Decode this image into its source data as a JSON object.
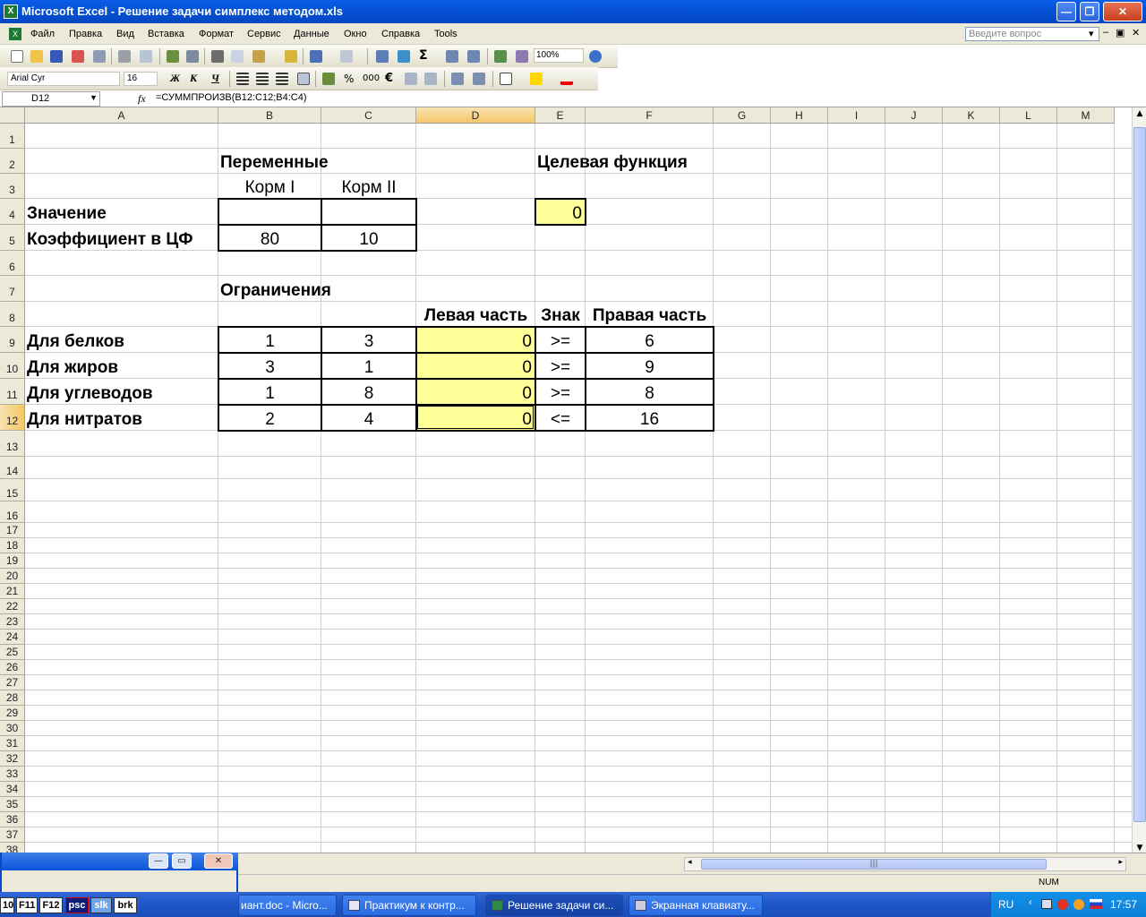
{
  "window": {
    "title": "Microsoft Excel - Решение задачи симплекс методом.xls"
  },
  "menu": {
    "items": [
      "Файл",
      "Правка",
      "Вид",
      "Вставка",
      "Формат",
      "Сервис",
      "Данные",
      "Окно",
      "Справка",
      "Tools"
    ],
    "ask_placeholder": "Введите вопрос"
  },
  "toolbar": {
    "zoom": "100%",
    "sigma": "Σ"
  },
  "format_toolbar": {
    "font": "Arial Cyr",
    "size": "16",
    "bold": "Ж",
    "italic": "К",
    "underline": "Ч",
    "percent": "%",
    "thousands": "000",
    "euro": "€"
  },
  "formula_bar": {
    "name_box": "D12",
    "fx": "fx",
    "formula": "=СУММПРОИЗВ(B12:C12;B4:C4)"
  },
  "columns": [
    "A",
    "B",
    "C",
    "D",
    "E",
    "F",
    "G",
    "H",
    "I",
    "J",
    "K",
    "L",
    "M"
  ],
  "rows": [
    "1",
    "2",
    "3",
    "4",
    "5",
    "6",
    "7",
    "8",
    "9",
    "10",
    "11",
    "12",
    "13",
    "14",
    "15",
    "16",
    "17",
    "18",
    "19",
    "20",
    "21",
    "22",
    "23",
    "24",
    "25",
    "26",
    "27",
    "28",
    "29",
    "30",
    "31",
    "32",
    "33",
    "34",
    "35",
    "36",
    "37",
    "38"
  ],
  "cells": {
    "B2": "Переменные",
    "E2": "Целевая функция",
    "B3": "Корм I",
    "C3": "Корм II",
    "A4": "Значение",
    "E4": "0",
    "A5": "Коэффициент в ЦФ",
    "B5": "80",
    "C5": "10",
    "B7": "Ограничения",
    "D8": "Левая часть",
    "E8": "Знак",
    "F8": "Правая часть",
    "A9": "Для белков",
    "B9": "1",
    "C9": "3",
    "D9": "0",
    "E9": ">=",
    "F9": "6",
    "A10": "Для жиров",
    "B10": "3",
    "C10": "1",
    "D10": "0",
    "E10": ">=",
    "F10": "9",
    "A11": "Для углеводов",
    "B11": "1",
    "C11": "8",
    "D11": "0",
    "E11": ">=",
    "F11": "8",
    "A12": "Для нитратов",
    "B12": "2",
    "C12": "4",
    "D12": "0",
    "E12": "<=",
    "F12": "16"
  },
  "status": {
    "num": "NUM"
  },
  "floating_window": {
    "minimize": "—",
    "restore": "▭",
    "close": "✕"
  },
  "taskbar": {
    "keys": [
      "10",
      "F11",
      "F12",
      "psc",
      "slk",
      "brk"
    ],
    "tasks": [
      "иант.doc - Micro...",
      "Практикум к контр...",
      "Решение задачи си...",
      "Экранная клавиату..."
    ],
    "lang": "RU",
    "clock": "17:57"
  },
  "colors": {
    "highlight_yellow": "#ffff99",
    "titlebar_blue": "#0653d6",
    "selected_header": "#f5c866"
  }
}
